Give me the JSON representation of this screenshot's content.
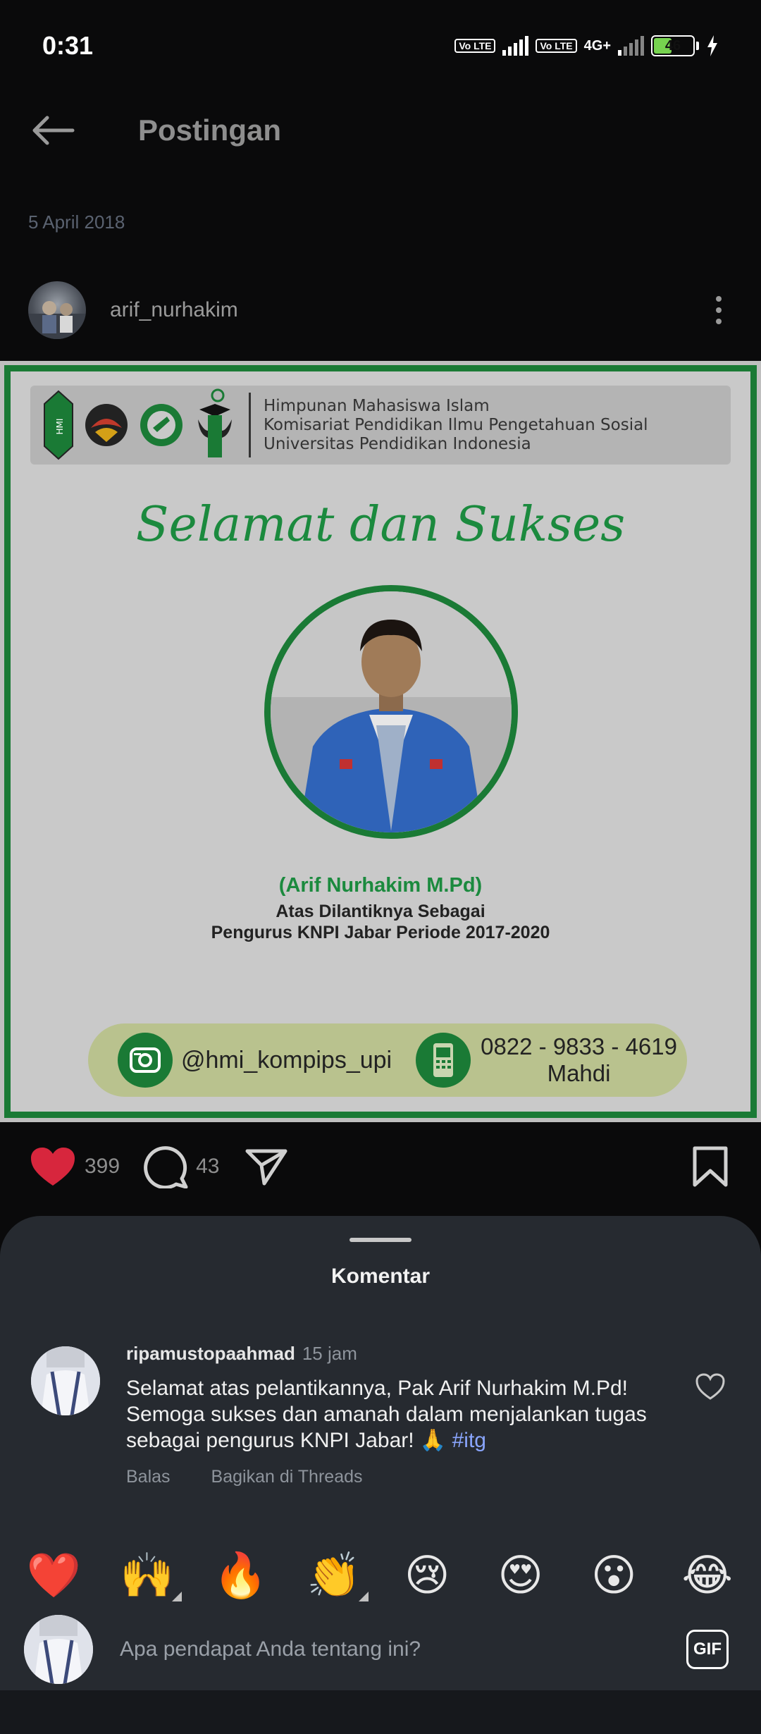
{
  "status_bar": {
    "time": "0:31",
    "volte1": "Vo LTE",
    "volte2": "Vo LTE",
    "network": "4G+",
    "battery": "46"
  },
  "header": {
    "back_icon": "arrow-left-icon",
    "title": "Postingan"
  },
  "post": {
    "date": "5 April 2018",
    "author": "arif_nurhakim",
    "image": {
      "org_lines": [
        "Himpunan Mahasiswa Islam",
        "Komisariat Pendidikan Ilmu Pengetahuan Sosial",
        "Universitas Pendidikan Indonesia"
      ],
      "logo_hmi_text": "HMI",
      "headline": "Selamat dan Sukses",
      "name": "(Arif Nurhakim M.Pd)",
      "line1": "Atas Dilantiknya Sebagai",
      "line2": "Pengurus KNPI Jabar Periode 2017-2020",
      "instagram": "@hmi_kompips_upi",
      "phone": "0822 - 9833 - 4619",
      "phone_name": "Mahdi",
      "frame_color": "#1a7a35",
      "headline_color": "#1b8a3e"
    },
    "likes": "399",
    "comments": "43"
  },
  "sheet": {
    "title": "Komentar",
    "comment": {
      "user": "ripamustopaahmad",
      "time": "15 jam",
      "text": "Selamat atas pelantikannya, Pak Arif Nurhakim M.Pd! Semoga sukses dan amanah dalam menjalankan tugas sebagai pengurus KNPI Jabar! 🙏",
      "hashtag": "#itg",
      "reply": "Balas",
      "share_threads": "Bagikan di Threads"
    },
    "emojis": [
      "❤️",
      "🙌",
      "🔥",
      "👏",
      "😢",
      "😍",
      "😮",
      "😂"
    ],
    "input_placeholder": "Apa pendapat Anda tentang ini?",
    "gif_label": "GIF"
  },
  "colors": {
    "accent_like": "#d7263d",
    "sheet_bg": "#262a30",
    "hashtag": "#8aa6ff"
  }
}
